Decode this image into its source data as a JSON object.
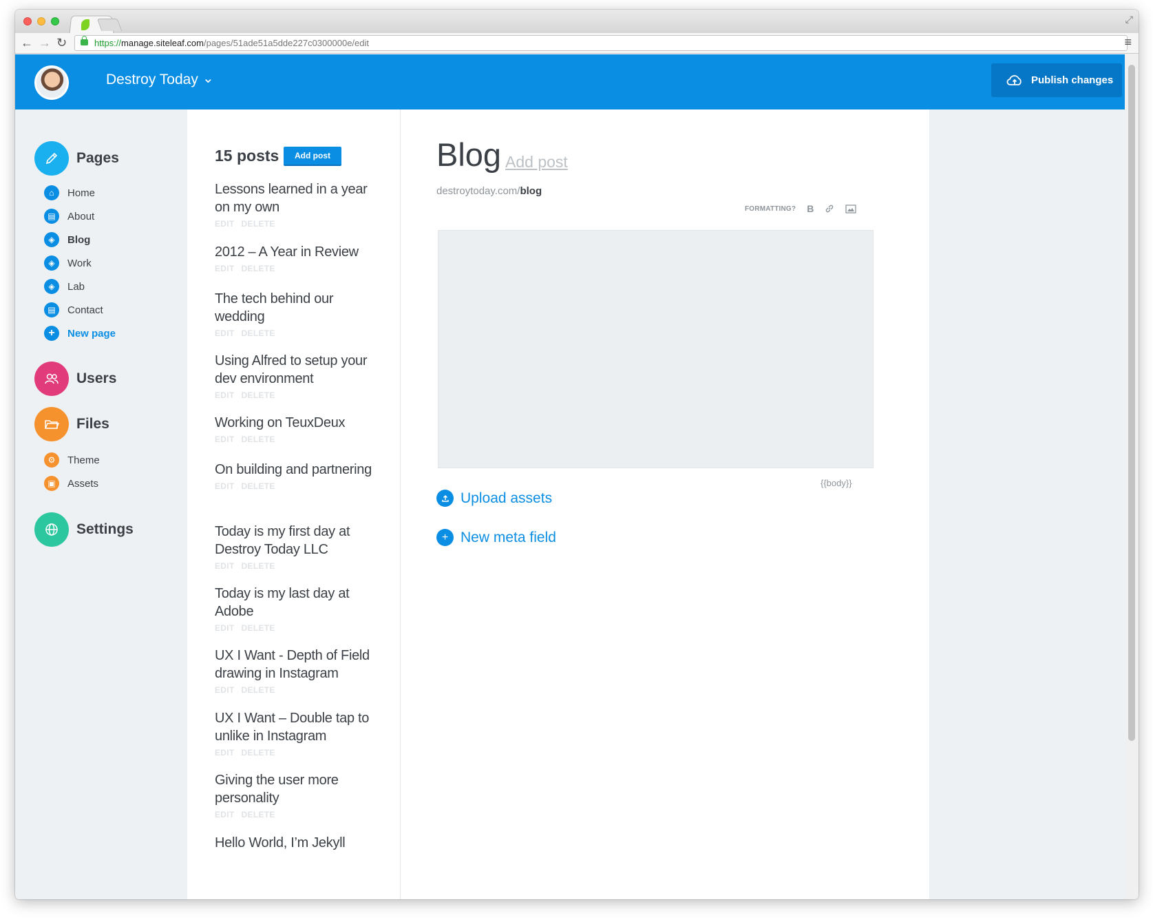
{
  "browser": {
    "url_scheme": "https://",
    "url_host": "manage.siteleaf.com",
    "url_path": "/pages/51ade51a5dde227c0300000e/edit"
  },
  "header": {
    "site_name": "Destroy Today",
    "publish_label": "Publish changes",
    "accent_color": "#0a8ee3"
  },
  "sidebar": {
    "pages_label": "Pages",
    "pages": [
      {
        "label": "Home",
        "icon": "home-icon"
      },
      {
        "label": "About",
        "icon": "document-icon"
      },
      {
        "label": "Blog",
        "icon": "layers-icon",
        "active": true
      },
      {
        "label": "Work",
        "icon": "layers-icon"
      },
      {
        "label": "Lab",
        "icon": "layers-icon"
      },
      {
        "label": "Contact",
        "icon": "document-icon"
      }
    ],
    "new_page_label": "New page",
    "users_label": "Users",
    "files_label": "Files",
    "files": [
      {
        "label": "Theme",
        "icon": "theme-icon"
      },
      {
        "label": "Assets",
        "icon": "image-icon"
      }
    ],
    "settings_label": "Settings",
    "colors": {
      "pages": "#1ab0ef",
      "users": "#e23b7c",
      "files": "#f6922e",
      "settings": "#2cc69f"
    }
  },
  "posts": {
    "count_label": "15 posts",
    "add_label": "Add post",
    "edit_label": "EDIT",
    "delete_label": "DELETE",
    "items": [
      {
        "title": "Lessons learned in a year on my own"
      },
      {
        "title": "2012 – A Year in Review"
      },
      {
        "title": "The tech behind our wedding"
      },
      {
        "title": "Using Alfred to setup your dev environment"
      },
      {
        "title": "Working on TeuxDeux"
      },
      {
        "title": "On building and partnering"
      },
      {
        "title": "Today is my first day at Destroy Today LLC"
      },
      {
        "title": "Today is my last day at Adobe"
      },
      {
        "title": "UX I Want - Depth of Field drawing in Instagram"
      },
      {
        "title": "UX I Want – Double tap to unlike in Instagram"
      },
      {
        "title": "Giving the user more personality"
      },
      {
        "title": "Hello World, I’m Jekyll"
      }
    ]
  },
  "editor": {
    "title": "Blog",
    "add_post_link": "Add post",
    "url_base": "destroytoday.com/",
    "url_slug": "blog",
    "formatting_label": "FORMATTING?",
    "body_tag": "{{body}}",
    "upload_label": "Upload assets",
    "meta_label": "New meta field"
  }
}
